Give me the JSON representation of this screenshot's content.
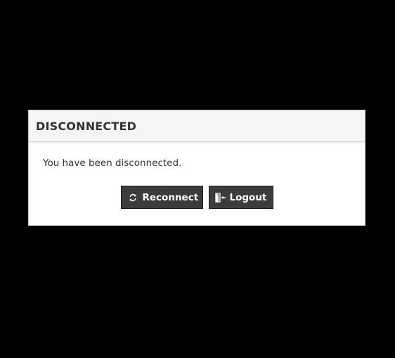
{
  "dialog": {
    "title": "DISCONNECTED",
    "message": "You have been disconnected.",
    "buttons": {
      "reconnect": {
        "label": "Reconnect",
        "icon": "refresh-icon"
      },
      "logout": {
        "label": "Logout",
        "icon": "logout-door-icon"
      }
    }
  },
  "colors": {
    "background": "#000000",
    "dialog_bg": "#ffffff",
    "header_bg": "#f5f5f5",
    "button_bg": "#3c3c3c",
    "text": "#333333"
  }
}
